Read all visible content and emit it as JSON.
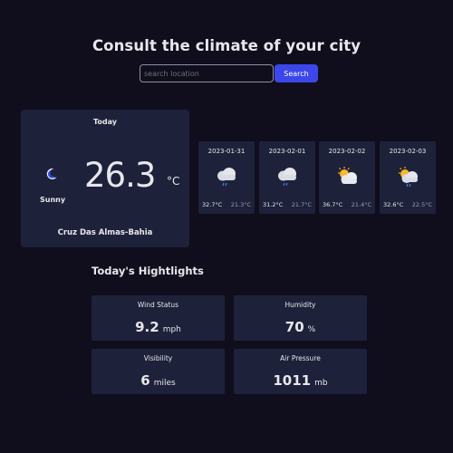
{
  "page": {
    "title": "Consult the climate of your city"
  },
  "search": {
    "placeholder": "search location",
    "value": "",
    "button_label": "Search"
  },
  "today": {
    "label": "Today",
    "condition": "Sunny",
    "icon": "moon-icon",
    "temperature": "26.3",
    "unit": "°C",
    "location": "Cruz Das Almas-Bahia"
  },
  "forecast": [
    {
      "date": "2023-01-31",
      "icon": "cloud-rain-icon",
      "max": "32.7°C",
      "min": "21.3°C"
    },
    {
      "date": "2023-02-01",
      "icon": "cloud-rain-icon",
      "max": "31.2°C",
      "min": "21.7°C"
    },
    {
      "date": "2023-02-02",
      "icon": "partly-cloudy-icon",
      "max": "36.7°C",
      "min": "21.4°C"
    },
    {
      "date": "2023-02-03",
      "icon": "partly-cloudy-rain-icon",
      "max": "32.6°C",
      "min": "22.5°C"
    }
  ],
  "highlights": {
    "title": "Today's Hightlights",
    "wind": {
      "label": "Wind Status",
      "value": "9.2",
      "unit": "mph"
    },
    "humidity": {
      "label": "Humidity",
      "value": "70",
      "unit": "%"
    },
    "visibility": {
      "label": "Visibility",
      "value": "6",
      "unit": "miles"
    },
    "pressure": {
      "label": "Air Pressure",
      "value": "1011",
      "unit": "mb"
    }
  },
  "colors": {
    "background": "#100e1d",
    "card": "#1e213a",
    "accent": "#3c47e9",
    "text": "#e7e7eb",
    "muted": "#a09fb1"
  }
}
